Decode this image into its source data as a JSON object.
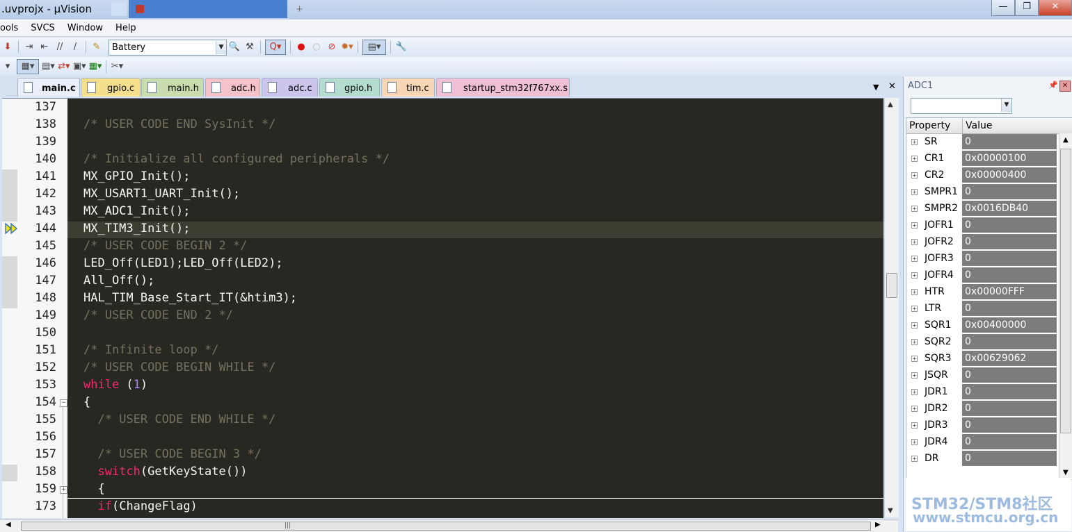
{
  "window": {
    "title": ".uvprojx - µVision",
    "buttons": {
      "minimize": "—",
      "maximize": "❐",
      "close": "✕"
    },
    "bg_tab_plus": "+"
  },
  "menu": [
    "ools",
    "SVCS",
    "Window",
    "Help"
  ],
  "toolbar": {
    "target_name": "Battery"
  },
  "tabs": [
    {
      "label": "main.c",
      "color": "#e9f0fb",
      "active": true
    },
    {
      "label": "gpio.c",
      "color": "#f4e08c",
      "active": false
    },
    {
      "label": "main.h",
      "color": "#c9dcae",
      "active": false
    },
    {
      "label": "adc.h",
      "color": "#f6c2c9",
      "active": false
    },
    {
      "label": "adc.c",
      "color": "#cdc4ee",
      "active": false
    },
    {
      "label": "gpio.h",
      "color": "#b4ddcf",
      "active": false
    },
    {
      "label": "tim.c",
      "color": "#f6d6b5",
      "active": false
    },
    {
      "label": "startup_stm32f767xx.s",
      "color": "#efbfd3",
      "active": false
    }
  ],
  "tab_controls": {
    "dropdown": "▼",
    "close": "✕"
  },
  "editor": {
    "current_line": "144",
    "lines": [
      {
        "num": "137",
        "parts": []
      },
      {
        "num": "138",
        "parts": [
          {
            "t": "/* USER CODE END SysInit */",
            "c": "cm"
          }
        ]
      },
      {
        "num": "139",
        "parts": []
      },
      {
        "num": "140",
        "parts": [
          {
            "t": "/* Initialize all configured peripherals */",
            "c": "cm"
          }
        ]
      },
      {
        "num": "141",
        "parts": [
          {
            "t": "MX_GPIO_Init();",
            "c": ""
          }
        ]
      },
      {
        "num": "142",
        "parts": [
          {
            "t": "MX_USART1_UART_Init();",
            "c": ""
          }
        ]
      },
      {
        "num": "143",
        "parts": [
          {
            "t": "MX_ADC1_Init();",
            "c": ""
          }
        ]
      },
      {
        "num": "144",
        "parts": [
          {
            "t": "MX_TIM3_Init();",
            "c": ""
          }
        ]
      },
      {
        "num": "145",
        "parts": [
          {
            "t": "/* USER CODE BEGIN 2 */",
            "c": "cm"
          }
        ]
      },
      {
        "num": "146",
        "parts": [
          {
            "t": "LED_Off(LED1);LED_Off(LED2);",
            "c": ""
          }
        ]
      },
      {
        "num": "147",
        "parts": [
          {
            "t": "All_Off();",
            "c": ""
          }
        ]
      },
      {
        "num": "148",
        "parts": [
          {
            "t": "HAL_TIM_Base_Start_IT(&htim3);",
            "c": ""
          }
        ]
      },
      {
        "num": "149",
        "parts": [
          {
            "t": "/* USER CODE END 2 */",
            "c": "cm"
          }
        ]
      },
      {
        "num": "150",
        "parts": []
      },
      {
        "num": "151",
        "parts": [
          {
            "t": "/* Infinite loop */",
            "c": "cm"
          }
        ]
      },
      {
        "num": "152",
        "parts": [
          {
            "t": "/* USER CODE BEGIN WHILE */",
            "c": "cm"
          }
        ]
      },
      {
        "num": "153",
        "parts": [
          {
            "t": "while",
            "c": "kw"
          },
          {
            "t": " (",
            "c": ""
          },
          {
            "t": "1",
            "c": "nm"
          },
          {
            "t": ")",
            "c": ""
          }
        ]
      },
      {
        "num": "154",
        "parts": [
          {
            "t": "{",
            "c": ""
          }
        ]
      },
      {
        "num": "155",
        "parts": [
          {
            "t": "  /* USER CODE END WHILE */",
            "c": "cm"
          }
        ]
      },
      {
        "num": "156",
        "parts": []
      },
      {
        "num": "157",
        "parts": [
          {
            "t": "  /* USER CODE BEGIN 3 */",
            "c": "cm"
          }
        ]
      },
      {
        "num": "158",
        "parts": [
          {
            "t": "  ",
            "c": ""
          },
          {
            "t": "switch",
            "c": "kw"
          },
          {
            "t": "(GetKeyState())",
            "c": ""
          }
        ]
      },
      {
        "num": "159",
        "parts": [
          {
            "t": "  {",
            "c": ""
          }
        ]
      },
      {
        "num": "173",
        "parts": [
          {
            "t": "  ",
            "c": ""
          },
          {
            "t": "if",
            "c": "kw"
          },
          {
            "t": "(ChangeFlag)",
            "c": ""
          }
        ]
      }
    ]
  },
  "panel": {
    "title": "ADC1",
    "pin_glyph": "📌",
    "close_glyph": "✕",
    "columns": {
      "property": "Property",
      "value": "Value"
    },
    "registers": [
      {
        "name": "SR",
        "value": "0"
      },
      {
        "name": "CR1",
        "value": "0x00000100"
      },
      {
        "name": "CR2",
        "value": "0x00000400"
      },
      {
        "name": "SMPR1",
        "value": "0"
      },
      {
        "name": "SMPR2",
        "value": "0x0016DB40"
      },
      {
        "name": "JOFR1",
        "value": "0"
      },
      {
        "name": "JOFR2",
        "value": "0"
      },
      {
        "name": "JOFR3",
        "value": "0"
      },
      {
        "name": "JOFR4",
        "value": "0"
      },
      {
        "name": "HTR",
        "value": "0x00000FFF"
      },
      {
        "name": "LTR",
        "value": "0"
      },
      {
        "name": "SQR1",
        "value": "0x00400000"
      },
      {
        "name": "SQR2",
        "value": "0"
      },
      {
        "name": "SQR3",
        "value": "0x00629062"
      },
      {
        "name": "JSQR",
        "value": "0"
      },
      {
        "name": "JDR1",
        "value": "0"
      },
      {
        "name": "JDR2",
        "value": "0"
      },
      {
        "name": "JDR3",
        "value": "0"
      },
      {
        "name": "JDR4",
        "value": "0"
      },
      {
        "name": "DR",
        "value": "0"
      }
    ]
  },
  "watermark": {
    "line1": "STM32/STM8社区",
    "line2": "www.stmcu.org.cn"
  },
  "colors": {
    "editor_bg": "#272822",
    "comment": "#75715e",
    "keyword": "#f92672",
    "number": "#ae81ff",
    "register_value_bg": "#7c7c7c"
  }
}
